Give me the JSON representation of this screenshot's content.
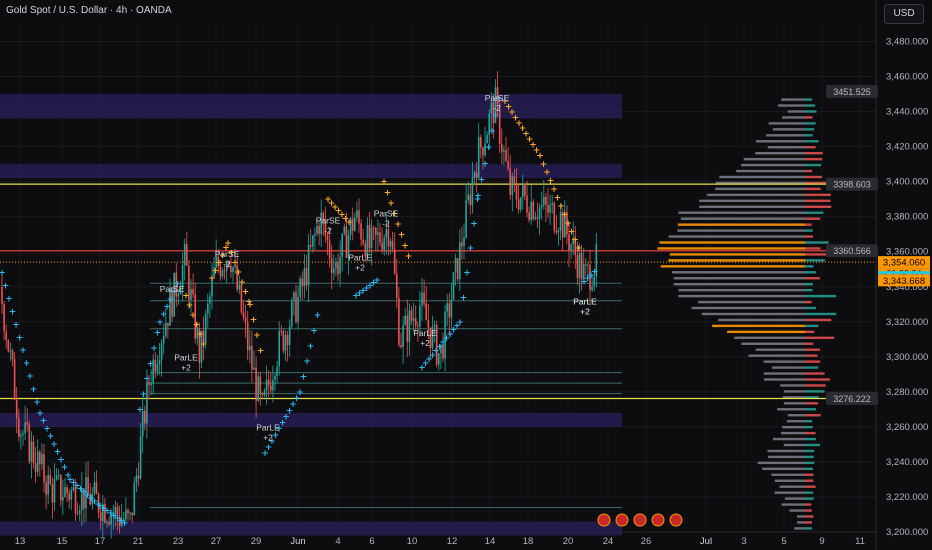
{
  "header": {
    "title": "Gold Spot / U.S. Dollar · 4h · OANDA",
    "currency": "USD"
  },
  "colors": {
    "background": "#0d0d0f",
    "up": "#26a69a",
    "down": "#ef5350",
    "resistance_line": "#e8e04a",
    "key_line": "#e53935",
    "zone": "#2a1f5c",
    "sar_long": "#29b6f6",
    "sar_short": "#ffa726",
    "profile_bar": "#787b86",
    "profile_poc": "#ff9800"
  },
  "chart_data": {
    "type": "candlestick",
    "ylim": [
      3200,
      3490
    ],
    "y_ticks": [
      3200,
      3220,
      3240,
      3260,
      3280,
      3300,
      3320,
      3340,
      3360,
      3380,
      3400,
      3420,
      3440,
      3460,
      3480
    ],
    "y_tick_labels": [
      "3,200.000",
      "3,220.000",
      "3,240.000",
      "3,260.000",
      "3,280.000",
      "3,300.000",
      "3,320.000",
      "3,340.000",
      "3,360.000",
      "3,380.000",
      "3,400.000",
      "3,420.000",
      "3,440.000",
      "3,460.000",
      "3,480.000"
    ],
    "x_tick_labels": [
      "13",
      "15",
      "17",
      "21",
      "23",
      "27",
      "29",
      "Jun",
      "4",
      "6",
      "10",
      "12",
      "14",
      "18",
      "20",
      "24",
      "26",
      "Jul",
      "3",
      "5",
      "9",
      "11"
    ],
    "zones": [
      [
        3436,
        3450
      ],
      [
        3402,
        3410
      ],
      [
        3260,
        3268
      ],
      [
        3198,
        3206
      ]
    ],
    "yellow_lines": [
      3398.603,
      3276.222
    ],
    "red_line": 3360.566,
    "price_labels": [
      {
        "value": 3451.525,
        "text": "3451.525"
      },
      {
        "value": 3398.603,
        "text": "3398.603"
      },
      {
        "value": 3360.566,
        "text": "3360.566"
      },
      {
        "value": 3276.222,
        "text": "3276.222"
      }
    ],
    "last_price": {
      "value": 3354.06,
      "text": "3,354.060",
      "countdown": "01:39:34"
    },
    "bid": {
      "value": 3345.49,
      "text": "3,345.490"
    },
    "ask": {
      "value": 3343.668,
      "text": "3,343.668"
    },
    "signals": [
      {
        "text": "ParSE",
        "sub": ""
      },
      {
        "text": "ParLE",
        "sub": "+2"
      },
      {
        "text": "ParSE",
        "sub": "-2"
      },
      {
        "text": "ParLE",
        "sub": "+2"
      },
      {
        "text": "ParSE",
        "sub": "-2"
      },
      {
        "text": "ParLE",
        "sub": "+2"
      },
      {
        "text": "ParSE",
        "sub": "-2"
      },
      {
        "text": "ParLE",
        "sub": "+2"
      },
      {
        "text": "ParLE",
        "sub": "+2"
      },
      {
        "text": "ParSE",
        "sub": "-2"
      },
      {
        "text": "ParLE",
        "sub": "+2"
      }
    ]
  }
}
